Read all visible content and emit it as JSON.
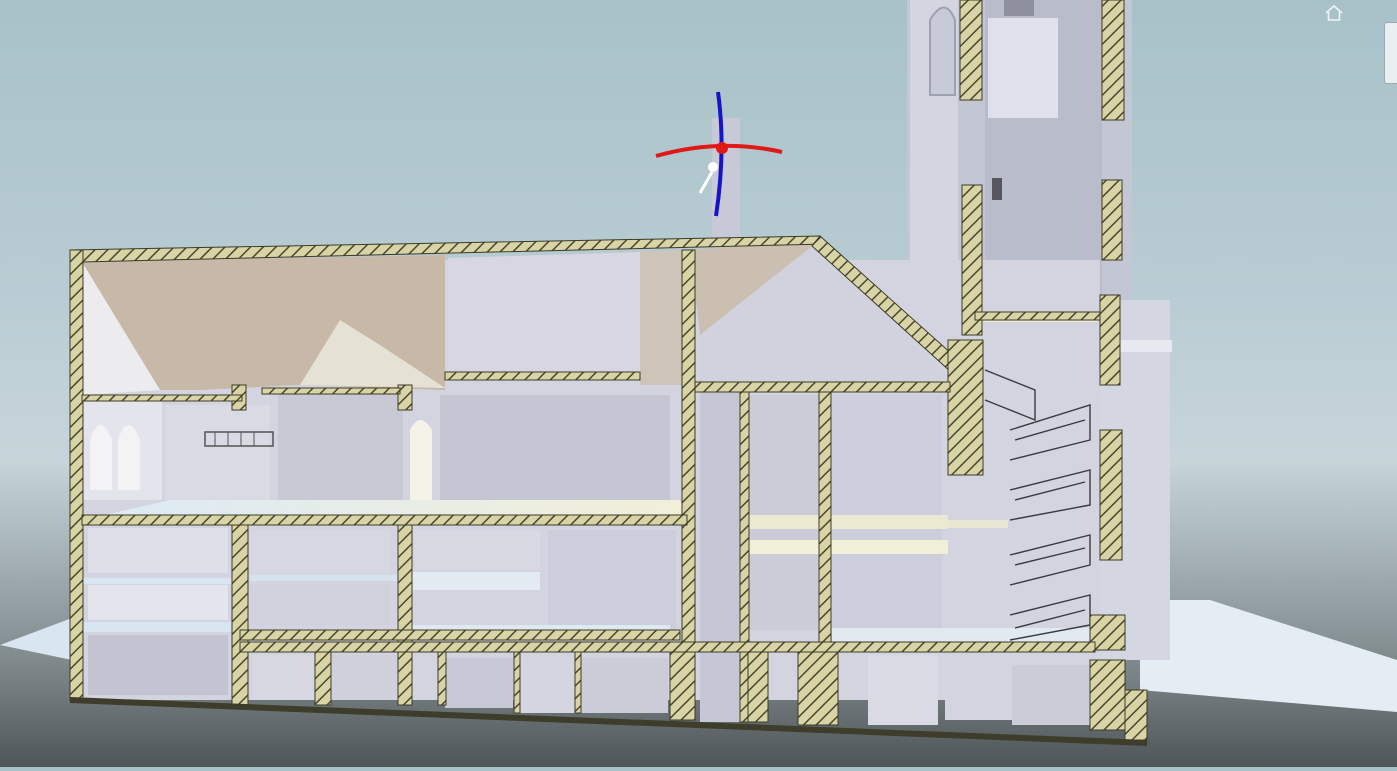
{
  "app": {
    "title": "",
    "view_mode": "3D section view",
    "nav_home_icon": "home-icon",
    "viewcube_icon": "viewcube-icon",
    "gizmo_icon": "move-rotate-gizmo-icon"
  },
  "colors": {
    "sky_top": "#a8c1c8",
    "ground_dark": "#5b6366",
    "cut_fill": "#d8d4a6",
    "cut_hatch": "#4a4730",
    "wall_light": "#e8e9f0",
    "wall_shadow": "#c9c9d6",
    "roof_underside": "#c8b9a9",
    "floor_slab": "#cfe0ee",
    "gizmo_x_axis": "#e01818",
    "gizmo_z_axis": "#1414c8"
  }
}
